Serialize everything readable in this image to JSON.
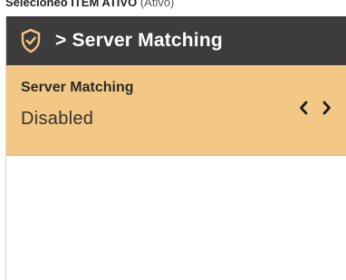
{
  "caption": {
    "bold": "Selecione​​​o ITEM ATIVO",
    "rest": "(Ativo)"
  },
  "header": {
    "title": "> Server Matching",
    "icon": "shield-check-icon"
  },
  "setting": {
    "label": "Server Matching",
    "value": "Disabled",
    "prev_icon": "chevron-left-icon",
    "next_icon": "chevron-right-icon"
  },
  "colors": {
    "header_bg": "#3d3b3b",
    "highlight_bg": "#f3c884",
    "header_text": "#ffffff"
  }
}
